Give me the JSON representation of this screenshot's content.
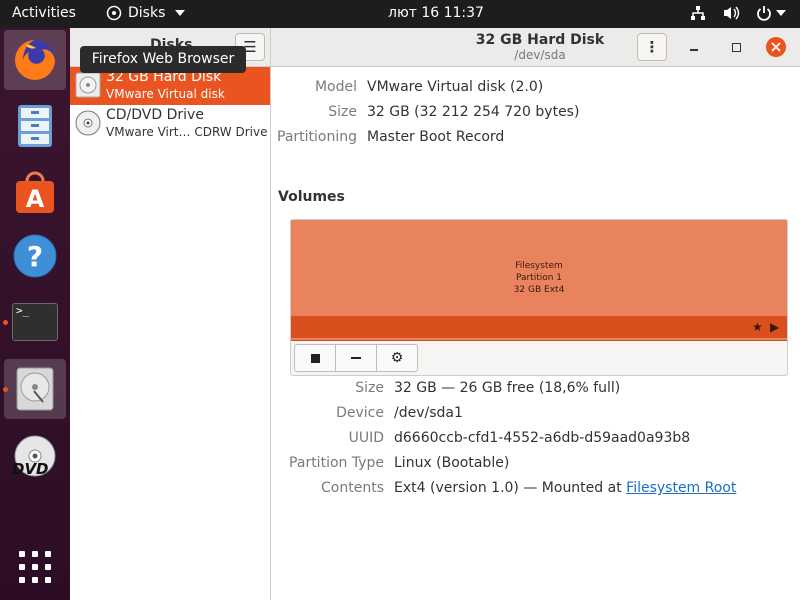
{
  "topbar": {
    "activities": "Activities",
    "app_name": "Disks",
    "clock": "лют 16  11:37"
  },
  "dock": {
    "items": [
      {
        "name": "Firefox Web Browser",
        "icon": "firefox-icon"
      },
      {
        "name": "Files",
        "icon": "files-icon"
      },
      {
        "name": "Ubuntu Software",
        "icon": "software-icon"
      },
      {
        "name": "Help",
        "icon": "help-icon"
      },
      {
        "name": "Terminal",
        "icon": "terminal-icon"
      },
      {
        "name": "Disks",
        "icon": "disks-icon"
      },
      {
        "name": "DVD",
        "icon": "dvd-icon",
        "label": "DVD"
      },
      {
        "name": "Show Applications",
        "icon": "app-grid-icon"
      }
    ],
    "tooltip": "Firefox Web Browser",
    "terminal_prompt": ">_"
  },
  "window": {
    "sidebar_title": "Disks",
    "title": "32 GB Hard Disk",
    "subtitle": "/dev/sda"
  },
  "disks": [
    {
      "name": "32 GB Hard Disk",
      "detail": "VMware Virtual disk"
    },
    {
      "name": "CD/DVD Drive",
      "detail": "VMware Virt… CDRW Drive"
    }
  ],
  "drive": {
    "model_label": "Model",
    "model": "VMware Virtual disk (2.0)",
    "size_label": "Size",
    "size": "32 GB (32 212 254 720 bytes)",
    "partitioning_label": "Partitioning",
    "partitioning": "Master Boot Record"
  },
  "volumes": {
    "title": "Volumes",
    "partition_line1": "Filesystem",
    "partition_line2": "Partition 1",
    "partition_line3": "32 GB Ext4"
  },
  "partition": {
    "size_label": "Size",
    "size": "32 GB — 26 GB free (18,6% full)",
    "device_label": "Device",
    "device": "/dev/sda1",
    "uuid_label": "UUID",
    "uuid": "d6660ccb-cfd1-4552-a6db-d59aad0a93b8",
    "type_label": "Partition Type",
    "type": "Linux (Bootable)",
    "contents_label": "Contents",
    "contents": "Ext4 (version 1.0) — Mounted at ",
    "contents_link": "Filesystem Root"
  },
  "colors": {
    "accent": "#e95420",
    "partition": "#e9835e",
    "link": "#1a6fc4"
  }
}
